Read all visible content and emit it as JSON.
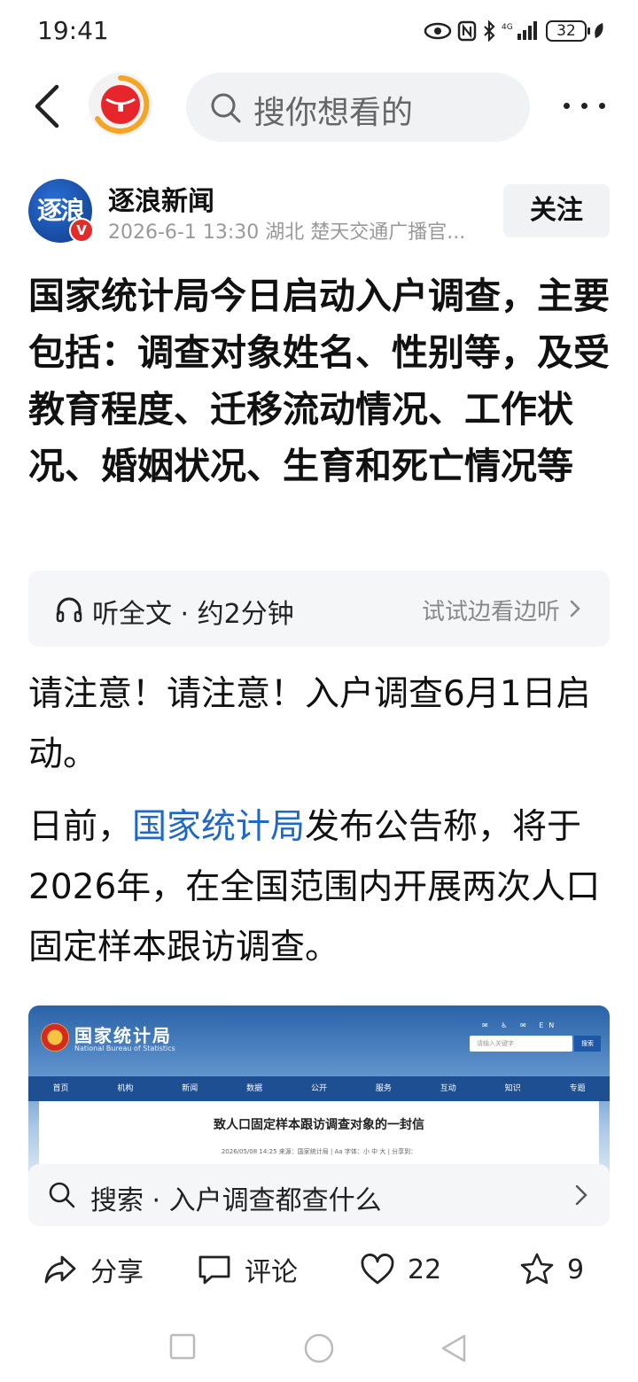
{
  "status_bar": {
    "time": "19:41",
    "battery": "32",
    "network": "4G"
  },
  "top_bar": {
    "search_placeholder": "搜你想看的"
  },
  "author": {
    "avatar_text": "逐浪",
    "badge": "V",
    "name": "逐浪新闻",
    "meta": "2026-6-1  13:30  湖北  楚天交通广播官...",
    "follow_label": "关注"
  },
  "article": {
    "title": "国家统计局今日启动入户调查，主要包括：调查对象姓名、性别等，及受教育程度、迁移流动情况、工作状况、婚姻状况、生育和死亡情况等",
    "listen_label": "听全文 · 约2分钟",
    "listen_side": "试试边看边听",
    "para1": "请注意！请注意！入户调查6月1日启动。",
    "para2_prefix": "日前，",
    "para2_link": "国家统计局",
    "para2_suffix": "发布公告称，将于2026年，在全国范围内开展两次人口固定样本跟访调查。"
  },
  "embedded_image": {
    "site_name": "国家统计局",
    "site_name_en": "National Bureau of Statistics",
    "search_placeholder": "请输入关键字",
    "search_button": "搜索",
    "top_icons": "✉ ♿ ✉ EN",
    "nav": [
      "首页",
      "机构",
      "新闻",
      "数据",
      "公开",
      "服务",
      "互动",
      "知识",
      "专题"
    ],
    "headline": "致人口固定样本跟访调查对象的一封信",
    "meta": "2026/05/08 14:25  来源：国家统计局  |  Aa 字体：小  中  大  |  分享到："
  },
  "search_suggest": {
    "text": "搜索 · 入户调查都查什么"
  },
  "actions": {
    "share_label": "分享",
    "comment_label": "评论",
    "like_count": "22",
    "fav_count": "9"
  },
  "colors": {
    "link": "#1f68c6",
    "badge_red": "#e62a2a",
    "follow_bg": "#f1f2f4"
  },
  "icons": [
    "back-icon",
    "app-logo-icon",
    "search-icon",
    "more-icon",
    "headphones-icon",
    "chevron-right-icon",
    "share-icon",
    "comment-icon",
    "heart-icon",
    "star-icon",
    "nav-square-icon",
    "nav-circle-icon",
    "nav-triangle-icon"
  ]
}
